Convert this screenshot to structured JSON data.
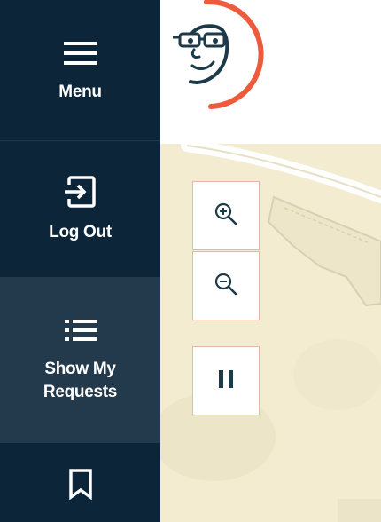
{
  "sidebar": {
    "menu": {
      "label": "Menu",
      "icon": "hamburger-icon"
    },
    "logout": {
      "label": "Log Out",
      "icon": "logout-icon"
    },
    "requests": {
      "label": "Show My Requests",
      "icon": "list-icon"
    },
    "bookmarks": {
      "icon": "bookmark-icon"
    }
  },
  "header": {
    "logo": "cartoon-face-logo"
  },
  "map": {
    "controls": {
      "zoom_in": {
        "icon": "zoom-in-icon"
      },
      "zoom_out": {
        "icon": "zoom-out-icon"
      },
      "pause": {
        "icon": "pause-icon"
      }
    }
  },
  "colors": {
    "sidebar": "#0c2538",
    "sidebar_active": "#23394c",
    "accent": "#ee5a3c",
    "map_land": "#f3ecd1",
    "control_border": "#e4b7a6"
  }
}
